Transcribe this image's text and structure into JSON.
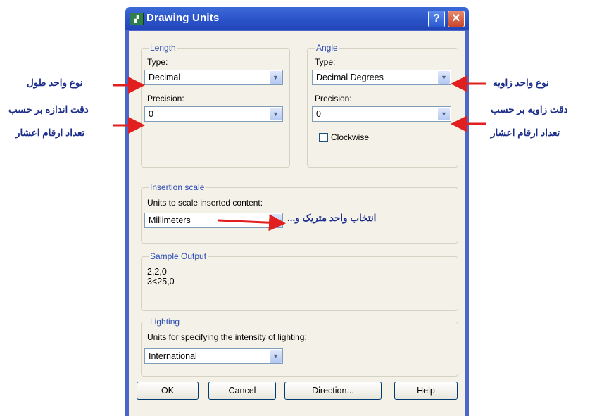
{
  "dialog": {
    "title": "Drawing Units",
    "help_glyph": "?",
    "close_glyph": "✕"
  },
  "length": {
    "group_label": "Length",
    "type_label": "Type:",
    "type_value": "Decimal",
    "precision_label": "Precision:",
    "precision_value": "0"
  },
  "angle": {
    "group_label": "Angle",
    "type_label": "Type:",
    "type_value": "Decimal Degrees",
    "precision_label": "Precision:",
    "precision_value": "0",
    "clockwise_label": "Clockwise",
    "clockwise_checked": false
  },
  "insertion": {
    "group_label": "Insertion scale",
    "units_label": "Units to scale inserted content:",
    "units_value": "Millimeters"
  },
  "sample": {
    "group_label": "Sample Output",
    "line1": "2,2,0",
    "line2": "3<25,0"
  },
  "lighting": {
    "group_label": "Lighting",
    "units_label": "Units for specifying the intensity of lighting:",
    "units_value": "International"
  },
  "buttons": {
    "ok": "OK",
    "cancel": "Cancel",
    "direction": "Direction...",
    "help": "Help"
  },
  "annotations": {
    "length_type": "نوع واحد طول",
    "length_precision_1": "دقت اندازه بر حسب",
    "length_precision_2": "تعداد ارقام اعشار",
    "angle_type": "نوع واحد زاویه",
    "angle_precision_1": "دقت زاویه بر حسب",
    "angle_precision_2": "تعداد ارقام اعشار",
    "insertion_units": "انتخاب واحد متریک و..."
  },
  "colors": {
    "annotation_text": "#1b2c8a",
    "annotation_arrow": "#e21f1f",
    "group_title": "#2b4bb4",
    "titlebar": "#2a52c8"
  },
  "icons": {
    "app": "autocad-drawing-units-icon",
    "combo_arrow": "chevron-down-icon"
  }
}
